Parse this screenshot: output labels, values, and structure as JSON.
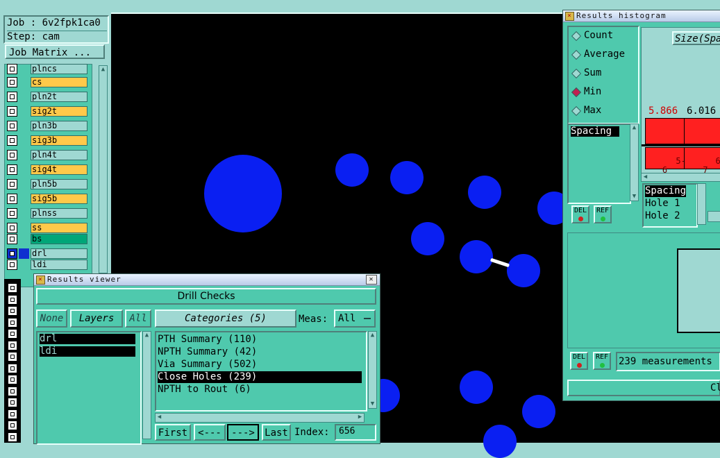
{
  "job_panel": {
    "job_label": "Job : 6v2fpk1ca0",
    "step_label": "Step: cam",
    "job_matrix_button": "Job Matrix ..."
  },
  "layers": [
    {
      "name": "plncs",
      "color": "#9fd8d2"
    },
    {
      "name": "cs",
      "color": "#ffc94a"
    },
    {
      "name": "pln2t",
      "color": "#9fd8d2"
    },
    {
      "name": "sig2t",
      "color": "#ffc94a"
    },
    {
      "name": "pln3b",
      "color": "#9fd8d2"
    },
    {
      "name": "sig3b",
      "color": "#ffc94a"
    },
    {
      "name": "pln4t",
      "color": "#9fd8d2"
    },
    {
      "name": "sig4t",
      "color": "#ffc94a"
    },
    {
      "name": "pln5b",
      "color": "#9fd8d2"
    },
    {
      "name": "sig5b",
      "color": "#ffc94a"
    },
    {
      "name": "plnss",
      "color": "#9fd8d2"
    },
    {
      "name": "ss",
      "color": "#ffc94a"
    },
    {
      "name": "bs",
      "color": "#00a678"
    },
    {
      "name": "drl",
      "color": "#9fd8d2"
    },
    {
      "name": "ldi",
      "color": "#9fd8d2"
    }
  ],
  "results_viewer": {
    "title": "Results viewer",
    "header": "Drill Checks",
    "none_button": "None",
    "layers_button": "Layers",
    "all_button": "All",
    "categories_button": "Categories (5)",
    "meas_label": "Meas:",
    "meas_value": "All",
    "layer_list": [
      "drl",
      "ldi"
    ],
    "categories": [
      "PTH Summary (110)",
      "NPTH Summary (42)",
      "Via Summary (502)",
      "Close Holes (239)",
      "NPTH to Rout (6)"
    ],
    "selected_category_index": 3,
    "nav": {
      "first": "First",
      "prev": "<---",
      "next": "--->",
      "last": "Last",
      "index_label": "Index:",
      "index_value": "656"
    }
  },
  "histogram": {
    "title": "Results histogram",
    "radio_options": [
      "Count",
      "Average",
      "Sum",
      "Min",
      "Max"
    ],
    "selected_radio": "Min",
    "list_item": "Spacing",
    "del_button": "DEL",
    "ref_button": "REF",
    "size_label": "Size(Spa",
    "bin_values": [
      "5.866",
      "6.016"
    ],
    "bin_labels": [
      "5-\n6",
      "6-\n7"
    ],
    "bar_color": "#ff2020",
    "info_items": [
      "Spacing",
      "Hole 1",
      "Hole 2"
    ],
    "measurement_count": "239 measurements",
    "close_button": "Cl"
  },
  "colors": {
    "panel": "#4fc9ad",
    "panel_light": "#9fd8d2",
    "canvas": "#000000",
    "hole": "#0a1ff2"
  }
}
